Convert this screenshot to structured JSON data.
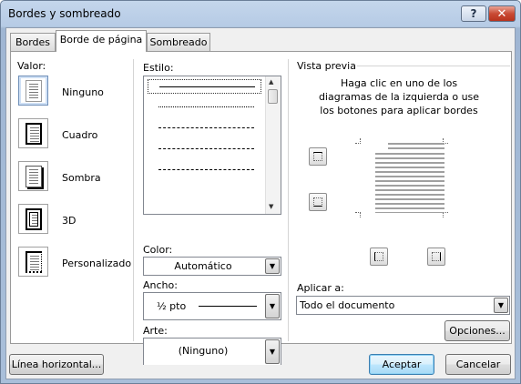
{
  "window": {
    "title": "Bordes y sombreado",
    "help_label": "?",
    "close_label": "✕"
  },
  "tabs": [
    {
      "label": "Bordes",
      "active": false
    },
    {
      "label": "Borde de página",
      "active": true
    },
    {
      "label": "Sombreado",
      "active": false
    }
  ],
  "setting": {
    "label": "Valor:",
    "items": [
      {
        "label": "Ninguno",
        "selected": true
      },
      {
        "label": "Cuadro",
        "selected": false
      },
      {
        "label": "Sombra",
        "selected": false
      },
      {
        "label": "3D",
        "selected": false
      },
      {
        "label": "Personalizado",
        "selected": false
      }
    ]
  },
  "style": {
    "label": "Estilo:",
    "items": [
      "solid",
      "dotted",
      "dashed-small",
      "dashed",
      "dash-dot"
    ]
  },
  "color": {
    "label": "Color:",
    "value": "Automático"
  },
  "width": {
    "label": "Ancho:",
    "value": "½ pto"
  },
  "art": {
    "label": "Arte:",
    "value": "(Ninguno)"
  },
  "preview": {
    "label": "Vista previa",
    "instructions": [
      "Haga clic en uno de los",
      "diagramas de la izquierda o use",
      "los botones para aplicar bordes"
    ]
  },
  "apply_to": {
    "label": "Aplicar a:",
    "value": "Todo el documento"
  },
  "buttons": {
    "options": "Opciones...",
    "horizontal_line": "Línea horizontal...",
    "accept": "Aceptar",
    "cancel": "Cancelar"
  },
  "icons": {
    "dropdown": "▼",
    "scroll_up": "▲",
    "scroll_down": "▼"
  }
}
